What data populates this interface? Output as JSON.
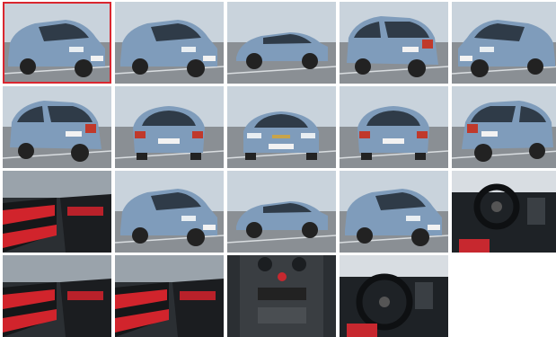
{
  "gallery": {
    "selected_index": 0,
    "accent_color": "#d9262f",
    "photos": [
      {
        "subject": "exterior-front-left",
        "kind": "exterior"
      },
      {
        "subject": "exterior-front-left",
        "kind": "exterior"
      },
      {
        "subject": "exterior-side-left",
        "kind": "exterior"
      },
      {
        "subject": "exterior-rear-left",
        "kind": "exterior"
      },
      {
        "subject": "exterior-front-right",
        "kind": "exterior"
      },
      {
        "subject": "exterior-rear-left",
        "kind": "exterior"
      },
      {
        "subject": "exterior-rear",
        "kind": "exterior"
      },
      {
        "subject": "exterior-front",
        "kind": "exterior"
      },
      {
        "subject": "exterior-rear",
        "kind": "exterior"
      },
      {
        "subject": "exterior-rear-right",
        "kind": "exterior"
      },
      {
        "subject": "interior-rear-seats",
        "kind": "interior"
      },
      {
        "subject": "exterior-front-left",
        "kind": "exterior"
      },
      {
        "subject": "exterior-side-left",
        "kind": "exterior"
      },
      {
        "subject": "exterior-front-left",
        "kind": "exterior"
      },
      {
        "subject": "interior-dashboard",
        "kind": "interior"
      },
      {
        "subject": "interior-front-seats",
        "kind": "interior"
      },
      {
        "subject": "interior-driver-seat",
        "kind": "interior"
      },
      {
        "subject": "interior-center-console",
        "kind": "interior"
      },
      {
        "subject": "interior-steering-wheel",
        "kind": "interior"
      }
    ]
  }
}
